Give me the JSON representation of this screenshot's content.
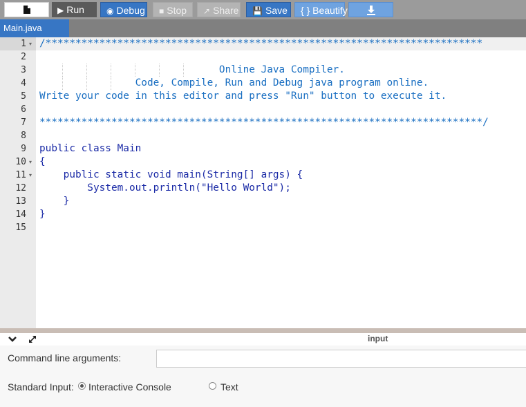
{
  "toolbar": {
    "file_icon": "file-icon",
    "run_label": "Run",
    "debug_label": "Debug",
    "stop_label": "Stop",
    "share_label": "Share",
    "save_label": "Save",
    "beautify_label": "{ } Beautify",
    "download_icon": "download-icon"
  },
  "tabs": [
    {
      "label": "Main.java",
      "active": true
    }
  ],
  "editor": {
    "language": "java",
    "active_line": 1,
    "lines": [
      {
        "num": "1",
        "fold": "▾",
        "text": "/*************************************************************************"
      },
      {
        "num": "2",
        "fold": "",
        "text": ""
      },
      {
        "num": "3",
        "fold": "",
        "text": "                              Online Java Compiler."
      },
      {
        "num": "4",
        "fold": "",
        "text": "                Code, Compile, Run and Debug java program online."
      },
      {
        "num": "5",
        "fold": "",
        "text": "Write your code in this editor and press \"Run\" button to execute it."
      },
      {
        "num": "6",
        "fold": "",
        "text": ""
      },
      {
        "num": "7",
        "fold": "",
        "text": "**************************************************************************/"
      },
      {
        "num": "8",
        "fold": "",
        "text": ""
      },
      {
        "num": "9",
        "fold": "",
        "text": "public class Main"
      },
      {
        "num": "10",
        "fold": "▾",
        "text": "{"
      },
      {
        "num": "11",
        "fold": "▾",
        "text": "    public static void main(String[] args) {"
      },
      {
        "num": "12",
        "fold": "",
        "text": "        System.out.println(\"Hello World\");"
      },
      {
        "num": "13",
        "fold": "",
        "text": "    }"
      },
      {
        "num": "14",
        "fold": "",
        "text": "}"
      },
      {
        "num": "15",
        "fold": "",
        "text": ""
      }
    ]
  },
  "input_panel": {
    "header_label": "input",
    "collapse_icon": "chevron-down-icon",
    "expand_icon": "expand-icon",
    "cmd_args_label": "Command line arguments:",
    "cmd_args_value": "",
    "stdin_label": "Standard Input:",
    "stdin_options": [
      {
        "label": "Interactive Console",
        "selected": true
      },
      {
        "label": "Text",
        "selected": false
      }
    ]
  },
  "colors": {
    "accent": "#3776c4",
    "comment": "#1a6fc2",
    "keyword": "#1a2aa6"
  }
}
